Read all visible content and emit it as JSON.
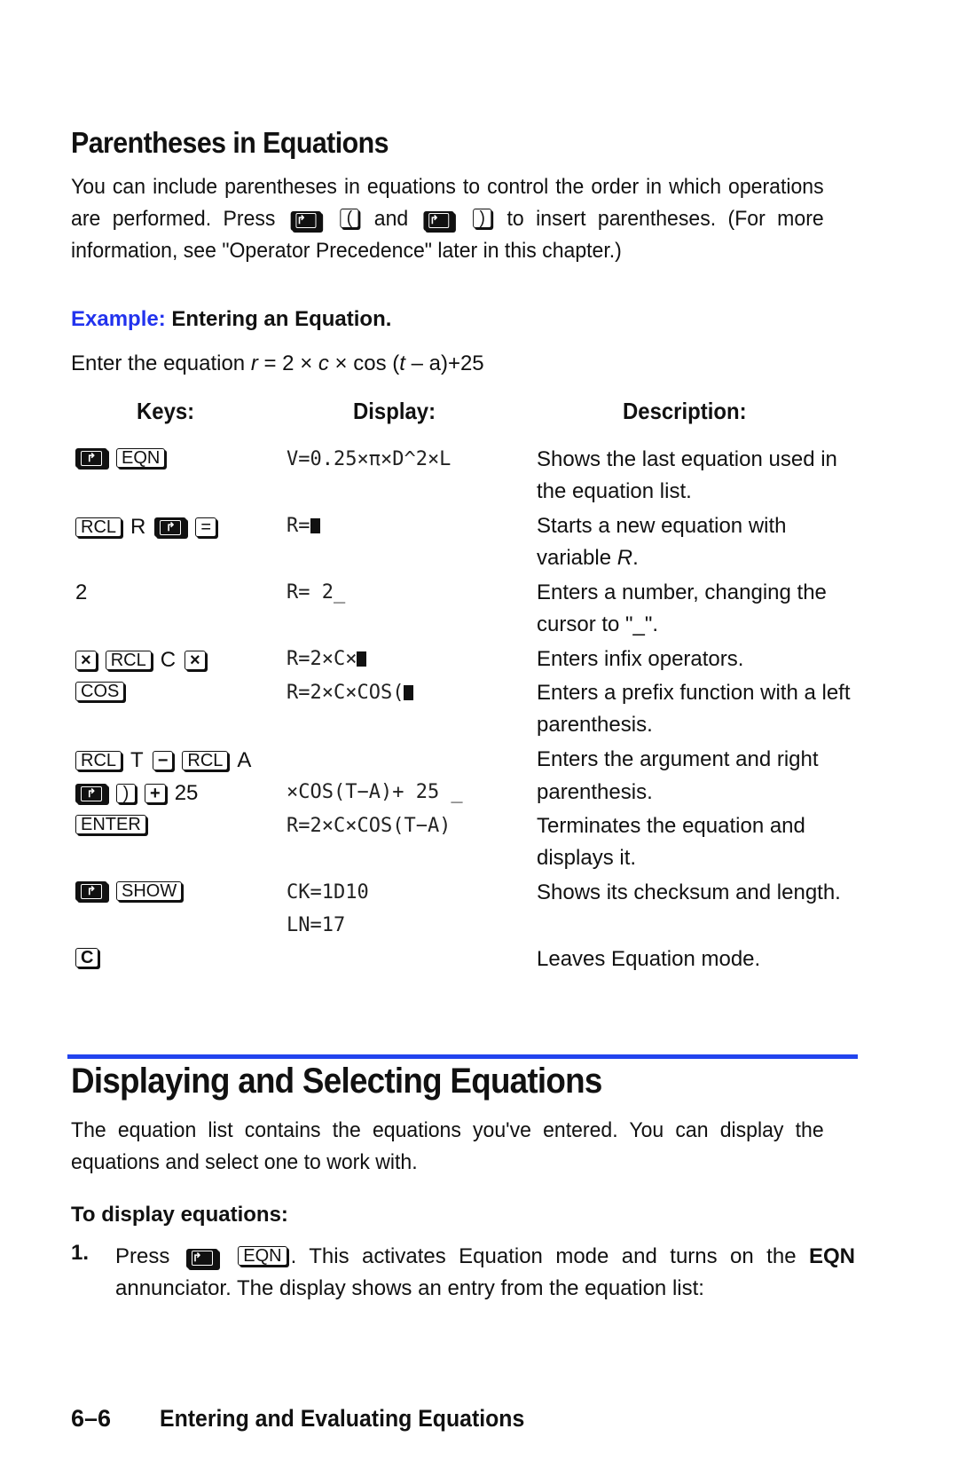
{
  "section1": {
    "title": "Parentheses in Equations",
    "para_line1": "You can include parentheses in equations to control the order in which operations",
    "para_line2_a": "are performed. Press",
    "para_line2_and": "and",
    "para_line2_b": "to insert parentheses. (For more",
    "para_line3": "information, see \"Operator Precedence\" later in this chapter.)",
    "key_left_paren": "(",
    "key_right_paren": ")"
  },
  "example": {
    "label": "Example:",
    "title": "Entering an Equation.",
    "intro_prefix": "Enter the equation ",
    "intro_r": "r",
    "intro_mid1": " = 2 × ",
    "intro_c": "c",
    "intro_mid2": " × cos (",
    "intro_t": "t",
    "intro_suffix": " – a)+25"
  },
  "table": {
    "headers": {
      "keys": "Keys:",
      "display": "Display:",
      "description": "Description:"
    },
    "rows": [
      {
        "keys": [
          "shift",
          "EQN"
        ],
        "display": "V=0.25×π×D^2×L",
        "description": "Shows the last equation used in the equation list."
      },
      {
        "keys": [
          "RCL",
          "R",
          "shift",
          "="
        ],
        "display": "R=",
        "display_cursor": "block",
        "description_prefix": "Starts a new equation with variable ",
        "description_italic": "R",
        "description_suffix": "."
      },
      {
        "keys": [
          "2"
        ],
        "display": "R= 2_",
        "description": "Enters a number, changing the cursor to \"_\"."
      },
      {
        "keys": [
          "×",
          "RCL",
          "C",
          "×"
        ],
        "display": "R=2×C×",
        "display_cursor": "block",
        "description": "Enters infix operators."
      },
      {
        "keys": [
          "COS"
        ],
        "display": "R=2×C×COS(",
        "display_cursor": "block",
        "description": "Enters a prefix function with a left parenthesis."
      },
      {
        "keys": [
          "RCL",
          "T",
          "−",
          "RCL",
          "A"
        ],
        "display": "",
        "description": "Enters the argument and right"
      },
      {
        "keys": [
          "shift",
          ")",
          "+",
          "25"
        ],
        "display": "×COS(T−A)+ 25 _",
        "description": "parenthesis."
      },
      {
        "keys": [
          "ENTER"
        ],
        "display": "R=2×C×COS(T−A)",
        "description": "Terminates the equation and displays it."
      },
      {
        "keys": [
          "shift",
          "SHOW"
        ],
        "display": "CK=1D10",
        "display2": "LN=17",
        "description": "Shows its checksum and length."
      },
      {
        "keys": [
          "C"
        ],
        "display": "",
        "description": "Leaves Equation mode."
      }
    ]
  },
  "section2": {
    "title": "Displaying and Selecting Equations",
    "para_line1": "The equation list contains the equations you've entered. You can display the",
    "para_line2": "equations and select one to work with.",
    "subhead": "To display equations:",
    "step1_num": "1.",
    "step1_a": "Press",
    "step1_key": "EQN",
    "step1_b": ". This activates Equation mode and turns on the",
    "step1_bold": "EQN",
    "step1_line2": "annunciator. The display shows an entry from the equation list:"
  },
  "footer": {
    "page": "6–6",
    "chapter": "Entering and Evaluating Equations"
  },
  "colors": {
    "accent_blue": "#2244ee",
    "text": "#111111"
  },
  "icons": {
    "shift_key": "right-shift-arrow-icon"
  }
}
